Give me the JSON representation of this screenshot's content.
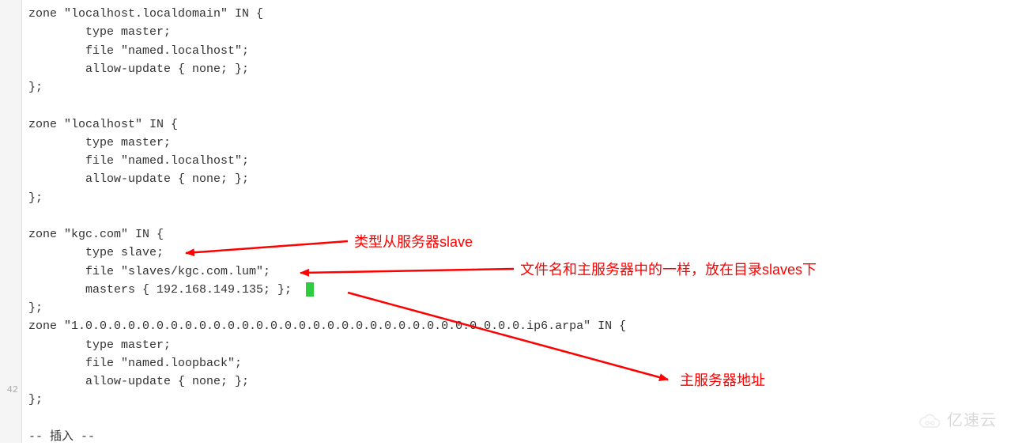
{
  "gutter": {
    "last_visible_line_number": "42"
  },
  "code": {
    "lines": [
      "zone \"localhost.localdomain\" IN {",
      "        type master;",
      "        file \"named.localhost\";",
      "        allow-update { none; };",
      "};",
      "",
      "zone \"localhost\" IN {",
      "        type master;",
      "        file \"named.localhost\";",
      "        allow-update { none; };",
      "};",
      "",
      "zone \"kgc.com\" IN {",
      "        type slave;",
      "        file \"slaves/kgc.com.lum\";",
      "        masters { 192.168.149.135; };",
      "};",
      "zone \"1.0.0.0.0.0.0.0.0.0.0.0.0.0.0.0.0.0.0.0.0.0.0.0.0.0.0.0.0.0.0.0.ip6.arpa\" IN {",
      "        type master;",
      "        file \"named.loopback\";",
      "        allow-update { none; };",
      "};",
      "",
      "-- 插入 --"
    ],
    "cursor": {
      "after_line_index": 15
    }
  },
  "annotations": {
    "type_slave_label": "类型从服务器slave",
    "file_slaves_label": "文件名和主服务器中的一样，放在目录slaves下",
    "masters_label": "主服务器地址"
  },
  "watermark": {
    "text": "亿速云"
  }
}
